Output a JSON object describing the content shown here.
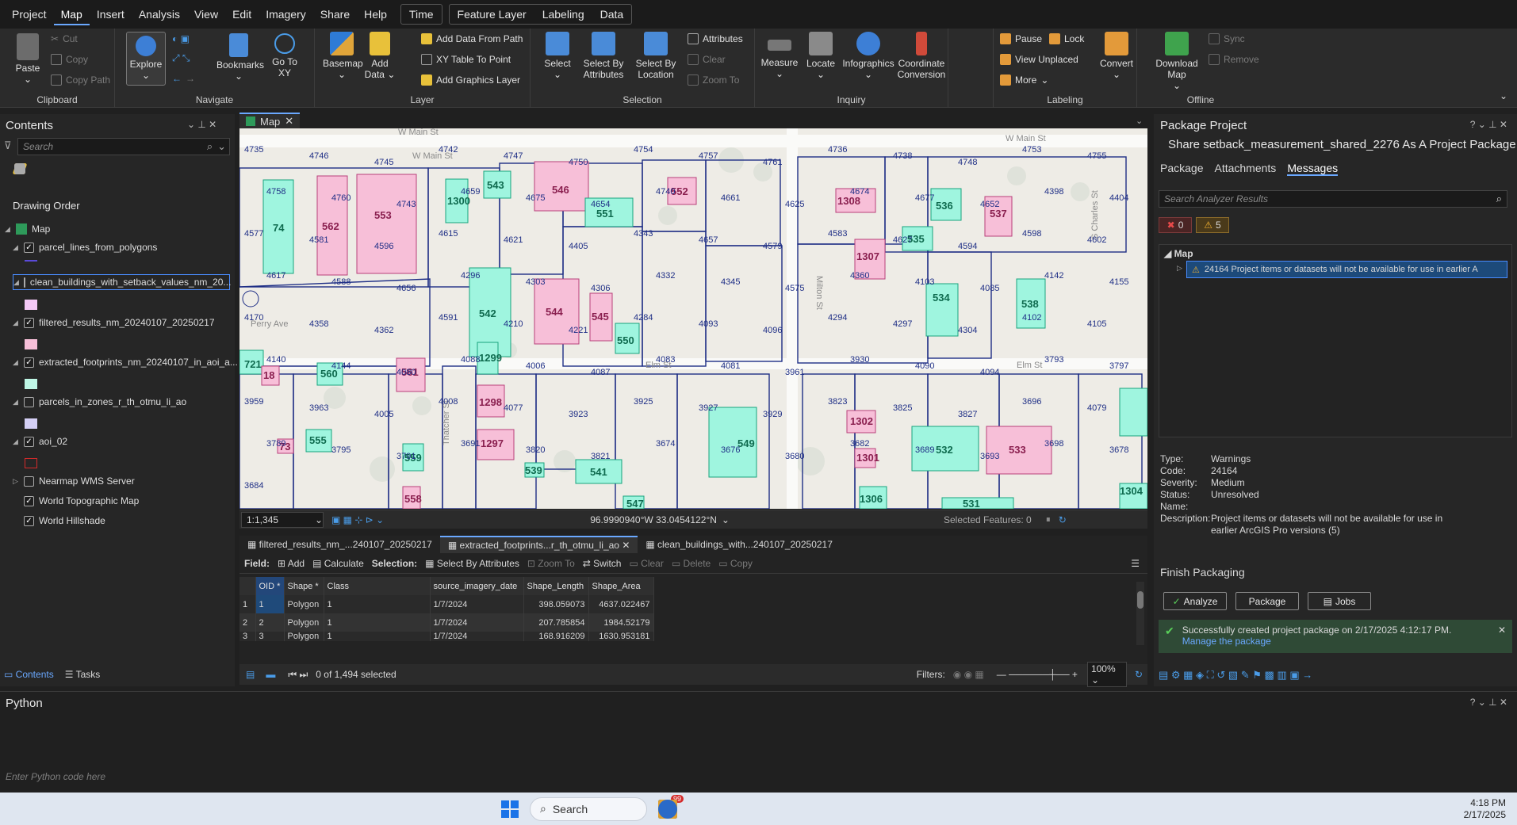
{
  "menu": {
    "items": [
      "Project",
      "Map",
      "Insert",
      "Analysis",
      "View",
      "Edit",
      "Imagery",
      "Share",
      "Help"
    ],
    "time": "Time",
    "context": [
      "Feature Layer",
      "Labeling",
      "Data"
    ]
  },
  "ribbon": {
    "clipboard": {
      "paste": "Paste",
      "cut": "Cut",
      "copy": "Copy",
      "copy_path": "Copy Path",
      "label": "Clipboard"
    },
    "navigate": {
      "explore": "Explore",
      "bookmarks": "Bookmarks",
      "goto": "Go To XY",
      "label": "Navigate"
    },
    "layer": {
      "basemap": "Basemap",
      "add_data": "Add Data",
      "add_from_path": "Add Data From Path",
      "xy_table": "XY Table To Point",
      "add_graphics": "Add Graphics Layer",
      "label": "Layer"
    },
    "selection": {
      "select": "Select",
      "by_attr": "Select By Attributes",
      "by_loc": "Select By Location",
      "attributes": "Attributes",
      "clear": "Clear",
      "zoom_to": "Zoom To",
      "label": "Selection"
    },
    "inquiry": {
      "measure": "Measure",
      "locate": "Locate",
      "infographics": "Infographics",
      "coord": "Coordinate Conversion",
      "label": "Inquiry"
    },
    "labeling": {
      "pause": "Pause",
      "lock": "Lock",
      "view_unplaced": "View Unplaced",
      "more": "More",
      "convert": "Convert",
      "label": "Labeling"
    },
    "offline": {
      "download": "Download Map",
      "sync": "Sync",
      "remove": "Remove",
      "label": "Offline"
    }
  },
  "contents": {
    "title": "Contents",
    "search_placeholder": "Search",
    "drawing_order": "Drawing Order",
    "map": "Map",
    "layers": [
      "parcel_lines_from_polygons",
      "clean_buildings_with_setback_values_nm_20...",
      "filtered_results_nm_20240107_20250217",
      "extracted_footprints_nm_20240107_in_aoi_a...",
      "parcels_in_zones_r_th_otmu_li_ao",
      "aoi_02",
      "Nearmap WMS Server",
      "World Topographic Map",
      "World Hillshade"
    ],
    "tabs": [
      "Contents",
      "Tasks"
    ]
  },
  "map_tab": "Map",
  "map": {
    "scale": "1:1,345",
    "coords": "96.9990940°W 33.0454122°N",
    "selected_features": "Selected Features: 0",
    "streets": [
      "W Main St",
      "W Main St",
      "W Main St",
      "Perry Ave",
      "Elm St",
      "Elm St",
      "Milton St",
      "S Charles St",
      "Thatcher St"
    ],
    "pink": [
      "562",
      "553",
      "546",
      "552",
      "1308",
      "537",
      "1307",
      "544",
      "545",
      "561",
      "18",
      "1298",
      "1297",
      "1302",
      "1301",
      "533",
      "558",
      "73"
    ],
    "green": [
      "74",
      "1300",
      "543",
      "551",
      "536",
      "535",
      "534",
      "538",
      "542",
      "550",
      "1299",
      "560",
      "555",
      "559",
      "539",
      "541",
      "549",
      "532",
      "531",
      "1306",
      "1304",
      "721",
      "547"
    ],
    "numbers": [
      "4735",
      "4746",
      "4745",
      "4742",
      "4747",
      "4750",
      "4754",
      "4757",
      "4761",
      "4736",
      "4738",
      "4748",
      "4753",
      "4755",
      "4758",
      "4760",
      "4743",
      "4659",
      "4675",
      "4654",
      "4740",
      "4661",
      "4625",
      "4674",
      "4677",
      "4652",
      "4398",
      "4404",
      "4577",
      "4581",
      "4596",
      "4615",
      "4621",
      "4405",
      "4343",
      "4657",
      "4579",
      "4583",
      "4627",
      "4594",
      "4598",
      "4602",
      "4617",
      "4588",
      "4656",
      "4296",
      "4303",
      "4306",
      "4332",
      "4345",
      "4575",
      "4360",
      "4103",
      "4085",
      "4142",
      "4155",
      "4170",
      "4358",
      "4362",
      "4591",
      "4210",
      "4221",
      "4284",
      "4093",
      "4096",
      "4294",
      "4297",
      "4304",
      "4102",
      "4105",
      "4140",
      "4144",
      "4080",
      "4088",
      "4006",
      "4087",
      "4083",
      "4081",
      "3961",
      "3930",
      "4090",
      "4094",
      "3793",
      "3797",
      "3959",
      "3963",
      "4005",
      "4008",
      "4077",
      "3923",
      "3925",
      "3927",
      "3929",
      "3823",
      "3825",
      "3827",
      "3696",
      "4079",
      "3789",
      "3795",
      "3791",
      "3691",
      "3820",
      "3821",
      "3674",
      "3676",
      "3680",
      "3682",
      "3689",
      "3693",
      "3698",
      "3678",
      "3684"
    ]
  },
  "attr_tabs": [
    "filtered_results_nm_...240107_20250217",
    "extracted_footprints...r_th_otmu_li_ao",
    "clean_buildings_with...240107_20250217"
  ],
  "attr_toolbar": {
    "field": "Field:",
    "add": "Add",
    "calculate": "Calculate",
    "selection": "Selection:",
    "select_by_attr": "Select By Attributes",
    "zoom_to": "Zoom To",
    "switch": "Switch",
    "clear": "Clear",
    "delete": "Delete",
    "copy": "Copy"
  },
  "table": {
    "headers": [
      "OID *",
      "Shape *",
      "Class",
      "source_imagery_date",
      "Shape_Length",
      "Shape_Area"
    ],
    "rows": [
      [
        "1",
        "1",
        "Polygon",
        "1",
        "1/7/2024",
        "398.059073",
        "4637.022467"
      ],
      [
        "2",
        "2",
        "Polygon",
        "1",
        "1/7/2024",
        "207.785854",
        "1984.52179"
      ],
      [
        "3",
        "3",
        "Polygon",
        "1",
        "1/7/2024",
        "168.916209",
        "1630.953181"
      ]
    ],
    "footer": "0 of 1,494 selected",
    "filters": "Filters:",
    "zoom": "100%"
  },
  "package": {
    "title": "Package Project",
    "subtitle": "Share setback_measurement_shared_2276 As A Project Package",
    "tabs": [
      "Package",
      "Attachments",
      "Messages"
    ],
    "search_placeholder": "Search Analyzer Results",
    "errors": "0",
    "warnings": "5",
    "tree_map": "Map",
    "message": "24164 Project items or datasets will not be available for use in earlier A",
    "details": {
      "type_k": "Type:",
      "type_v": "Warnings",
      "code_k": "Code:",
      "code_v": "24164",
      "sev_k": "Severity:",
      "sev_v": "Medium",
      "status_k": "Status:",
      "status_v": "Unresolved",
      "name_k": "Name:",
      "name_v": "",
      "desc_k": "Description:",
      "desc_v": "Project items or datasets will not be available for use in earlier ArcGIS Pro versions (5)"
    },
    "finish": "Finish Packaging",
    "analyze": "Analyze",
    "package_btn": "Package",
    "jobs": "Jobs",
    "success": "Successfully created project package on 2/17/2025 4:12:17 PM.",
    "manage": "Manage the package"
  },
  "python": {
    "title": "Python",
    "placeholder": "Enter Python code here"
  },
  "taskbar": {
    "search": "Search",
    "time": "4:18 PM",
    "date": "2/17/2025",
    "badge": "99"
  },
  "colors": {
    "accent": "#6aa8ff",
    "pink": "#f7bfd8",
    "green": "#9ff5df",
    "parcel_line": "#1f2f86"
  }
}
